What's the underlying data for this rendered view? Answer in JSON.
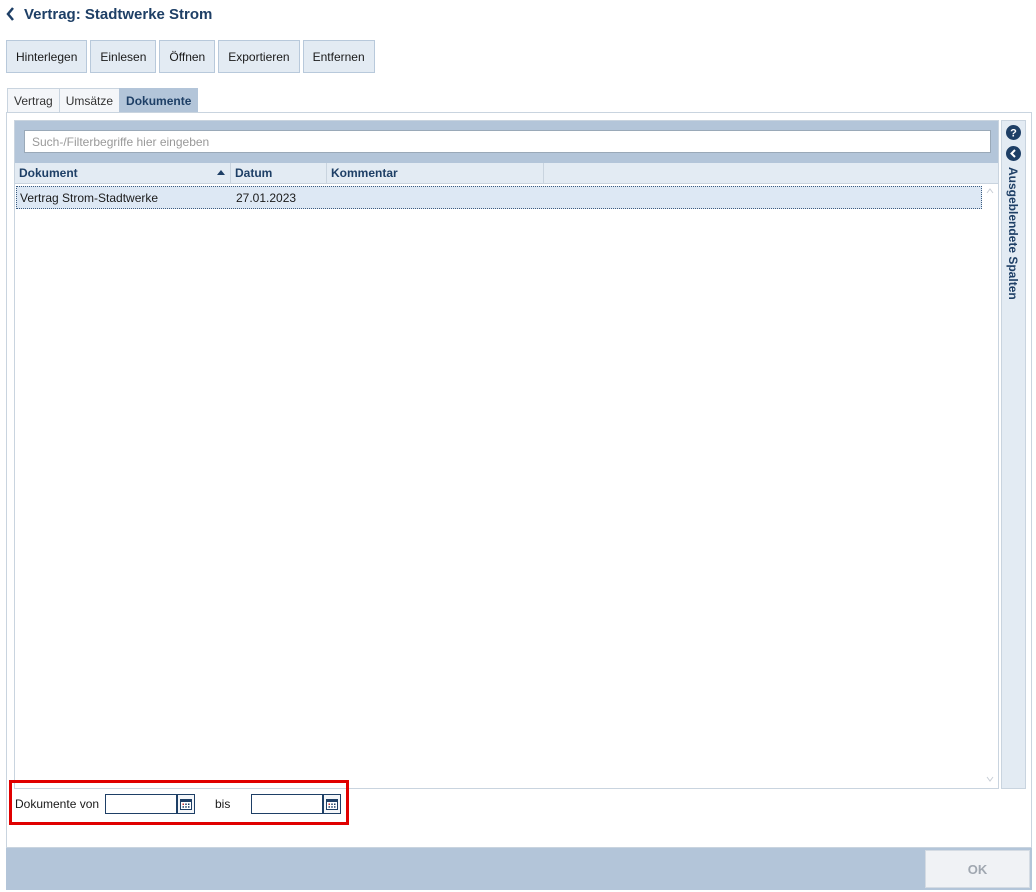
{
  "header": {
    "title": "Vertrag: Stadtwerke Strom"
  },
  "toolbar": {
    "buttons": [
      "Hinterlegen",
      "Einlesen",
      "Öffnen",
      "Exportieren",
      "Entfernen"
    ]
  },
  "tabs": [
    {
      "label": "Vertrag",
      "active": false
    },
    {
      "label": "Umsätze",
      "active": false
    },
    {
      "label": "Dokumente",
      "active": true
    }
  ],
  "search": {
    "placeholder": "Such-/Filterbegriffe hier eingeben",
    "value": ""
  },
  "grid": {
    "columns": [
      {
        "label": "Dokument",
        "sorted": "ascending"
      },
      {
        "label": "Datum"
      },
      {
        "label": "Kommentar"
      }
    ],
    "rows": [
      {
        "dokument": "Vertrag Strom-Stadtwerke",
        "datum": "27.01.2023",
        "kommentar": "",
        "selected": true
      }
    ]
  },
  "side_panel": {
    "label": "Ausgeblendete Spalten"
  },
  "date_filter": {
    "from_label": "Dokumente von",
    "to_label": "bis",
    "from_value": "",
    "to_value": ""
  },
  "footer": {
    "ok_label": "OK",
    "ok_enabled": false
  },
  "colors": {
    "accent": "#1e3f66",
    "panel": "#b3c5d9",
    "highlight": "#e00000",
    "row_selected": "#dde8f4"
  }
}
